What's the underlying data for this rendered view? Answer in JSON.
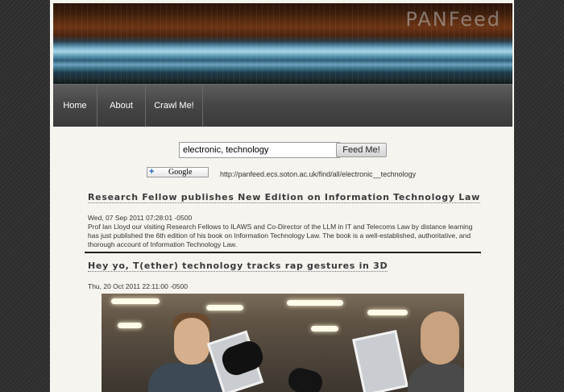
{
  "app": {
    "brand": "PANFeed"
  },
  "nav": {
    "items": [
      {
        "label": "Home"
      },
      {
        "label": "About"
      },
      {
        "label": "Crawl Me!"
      }
    ]
  },
  "search": {
    "value": "electronic, technology",
    "button_label": "Feed Me!"
  },
  "share": {
    "google_label": "Google",
    "feed_url": "http://panfeed.ecs.soton.ac.uk/find/all/electronic__technology"
  },
  "articles": [
    {
      "title": "Research Fellow publishes New Edition on Information Technology Law",
      "date": "Wed, 07 Sep 2011 07:28:01 -0500",
      "body": "Prof Ian Lloyd our visiting Research Fellows to ILAWS and Co-Director of the LLM in IT and Telecoms Law by distance learning has just published the 6th edition of his book on Information Technology Law. The book is a well-established, authoritative, and thorough account of Information Technology Law."
    },
    {
      "title": "Hey yo, T(ether) technology tracks rap gestures in 3D",
      "date": "Thu, 20 Oct 2011 22:11:00 -0500",
      "body": ""
    }
  ],
  "colors": {
    "nav_bg": "#474747",
    "page_bg": "#f6f4ef",
    "title_text": "#3a3a3a"
  },
  "icons": {
    "google_add": "plus-icon"
  }
}
